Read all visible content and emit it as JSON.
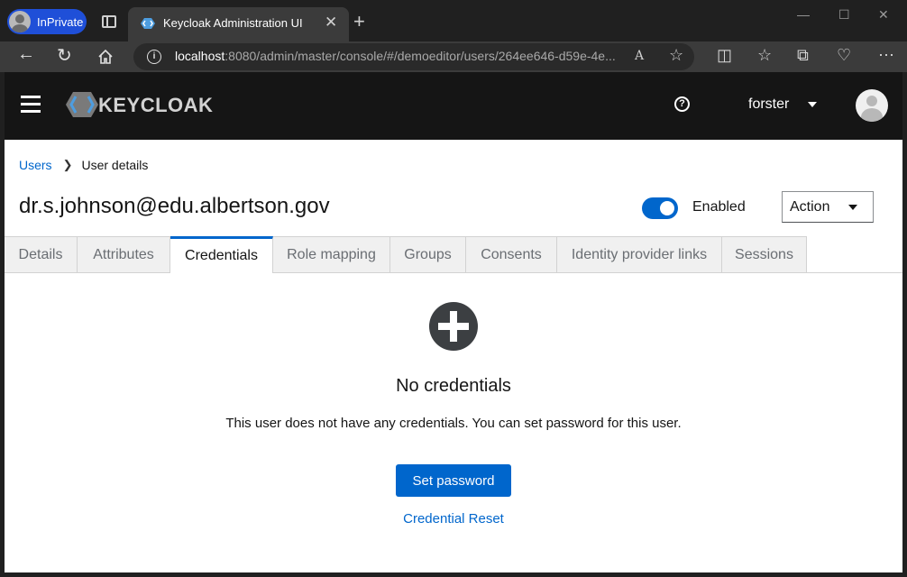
{
  "browser": {
    "inprivate_label": "InPrivate",
    "tab_title": "Keycloak Administration UI",
    "url_host": "localhost",
    "url_path": ":8080/admin/master/console/#/demoeditor/users/264ee646-d59e-4e..."
  },
  "header": {
    "logo_text": "KEYCLOAK",
    "username": "forster"
  },
  "breadcrumb": {
    "users": "Users",
    "current": "User details"
  },
  "user": {
    "title": "dr.s.johnson@edu.albertson.gov",
    "enabled_label": "Enabled",
    "enabled": true,
    "action_label": "Action"
  },
  "tabs": [
    {
      "label": "Details"
    },
    {
      "label": "Attributes"
    },
    {
      "label": "Credentials"
    },
    {
      "label": "Role mapping"
    },
    {
      "label": "Groups"
    },
    {
      "label": "Consents"
    },
    {
      "label": "Identity provider links"
    },
    {
      "label": "Sessions"
    }
  ],
  "empty_state": {
    "title": "No credentials",
    "body": "This user does not have any credentials. You can set password for this user.",
    "primary_button": "Set password",
    "secondary_link": "Credential Reset"
  },
  "colors": {
    "accent": "#0066cc",
    "header_bg": "#151515"
  }
}
